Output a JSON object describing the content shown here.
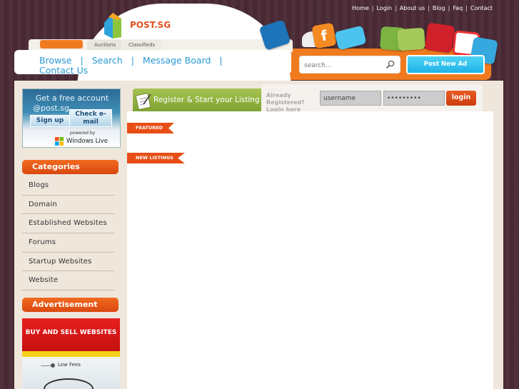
{
  "top_links": [
    "Home",
    "Login",
    "About us",
    "Blog",
    "Faq",
    "Contact"
  ],
  "logo": {
    "text": "POST.SG"
  },
  "tabs": [
    "Auctions",
    "Classifieds"
  ],
  "nav": {
    "browse": "Browse",
    "search": "Search",
    "message_board": "Message Board",
    "contact": "Contact Us",
    "sep": "|"
  },
  "search": {
    "placeholder": "search..."
  },
  "post_ad": {
    "label": "Post New Ad"
  },
  "windows_live": {
    "title": "Get a free account",
    "subtitle": "@post.sg",
    "signup": "Sign up",
    "check": "Check e-mail",
    "powered": "powered by",
    "brand": "Windows Live"
  },
  "categories": {
    "heading": "Categories",
    "items": [
      "Blogs",
      "Domain",
      "Established Websites",
      "Forums",
      "Startup Websites",
      "Website"
    ]
  },
  "advertisement": {
    "heading": "Advertisement",
    "banner_title": "BUY AND SELL WEBSITES",
    "banner_line": "Low Fees"
  },
  "register": {
    "text": "Register & Start your Listing"
  },
  "login": {
    "already": "Already Registered? Login here",
    "username": "username",
    "password": "•••••••••",
    "button": "login"
  },
  "ribbons": {
    "featured": "FEATURED",
    "new_listings": "NEW LISTINGS"
  },
  "colors": {
    "accent_orange": "#f07b1f",
    "link_blue": "#2a9ad6",
    "green": "#8fb03c",
    "cyan": "#22b6e8"
  }
}
